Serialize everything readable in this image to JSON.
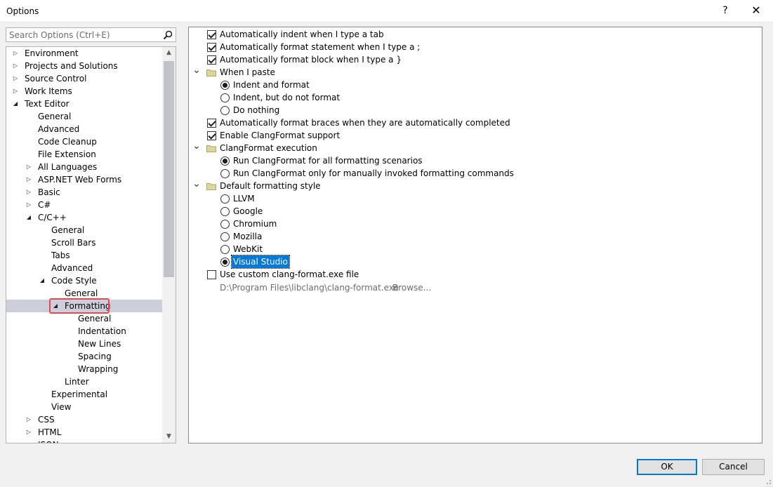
{
  "window": {
    "title": "Options",
    "help_label": "?",
    "close_label": "✕"
  },
  "search": {
    "placeholder": "Search Options (Ctrl+E)"
  },
  "tree": [
    {
      "label": "Environment",
      "indent": 0,
      "arrow": "collapsed"
    },
    {
      "label": "Projects and Solutions",
      "indent": 0,
      "arrow": "collapsed"
    },
    {
      "label": "Source Control",
      "indent": 0,
      "arrow": "collapsed"
    },
    {
      "label": "Work Items",
      "indent": 0,
      "arrow": "collapsed"
    },
    {
      "label": "Text Editor",
      "indent": 0,
      "arrow": "expanded"
    },
    {
      "label": "General",
      "indent": 1,
      "arrow": "none"
    },
    {
      "label": "Advanced",
      "indent": 1,
      "arrow": "none"
    },
    {
      "label": "Code Cleanup",
      "indent": 1,
      "arrow": "none"
    },
    {
      "label": "File Extension",
      "indent": 1,
      "arrow": "none"
    },
    {
      "label": "All Languages",
      "indent": 1,
      "arrow": "collapsed"
    },
    {
      "label": "ASP.NET Web Forms",
      "indent": 1,
      "arrow": "collapsed"
    },
    {
      "label": "Basic",
      "indent": 1,
      "arrow": "collapsed"
    },
    {
      "label": "C#",
      "indent": 1,
      "arrow": "collapsed"
    },
    {
      "label": "C/C++",
      "indent": 1,
      "arrow": "expanded"
    },
    {
      "label": "General",
      "indent": 2,
      "arrow": "none"
    },
    {
      "label": "Scroll Bars",
      "indent": 2,
      "arrow": "none"
    },
    {
      "label": "Tabs",
      "indent": 2,
      "arrow": "none"
    },
    {
      "label": "Advanced",
      "indent": 2,
      "arrow": "none"
    },
    {
      "label": "Code Style",
      "indent": 2,
      "arrow": "expanded"
    },
    {
      "label": "General",
      "indent": 3,
      "arrow": "none"
    },
    {
      "label": "Formatting",
      "indent": 3,
      "arrow": "expanded",
      "selected": true,
      "highlighted": true
    },
    {
      "label": "General",
      "indent": 4,
      "arrow": "none"
    },
    {
      "label": "Indentation",
      "indent": 4,
      "arrow": "none"
    },
    {
      "label": "New Lines",
      "indent": 4,
      "arrow": "none"
    },
    {
      "label": "Spacing",
      "indent": 4,
      "arrow": "none"
    },
    {
      "label": "Wrapping",
      "indent": 4,
      "arrow": "none"
    },
    {
      "label": "Linter",
      "indent": 3,
      "arrow": "none"
    },
    {
      "label": "Experimental",
      "indent": 2,
      "arrow": "none"
    },
    {
      "label": "View",
      "indent": 2,
      "arrow": "none"
    },
    {
      "label": "CSS",
      "indent": 1,
      "arrow": "collapsed"
    },
    {
      "label": "HTML",
      "indent": 1,
      "arrow": "collapsed"
    },
    {
      "label": "JSON",
      "indent": 1,
      "arrow": "collapsed"
    }
  ],
  "options": [
    {
      "kind": "checkbox",
      "label": "Automatically indent when I type a tab",
      "checked": true,
      "level": 1
    },
    {
      "kind": "checkbox",
      "label": "Automatically format statement when I type a ;",
      "checked": true,
      "level": 1
    },
    {
      "kind": "checkbox",
      "label": "Automatically format block when I type a }",
      "checked": true,
      "level": 1
    },
    {
      "kind": "group",
      "label": "When I paste",
      "level": 0
    },
    {
      "kind": "radio",
      "label": "Indent and format",
      "checked": true,
      "level": 2
    },
    {
      "kind": "radio",
      "label": "Indent, but do not format",
      "checked": false,
      "level": 2
    },
    {
      "kind": "radio",
      "label": "Do nothing",
      "checked": false,
      "level": 2
    },
    {
      "kind": "checkbox",
      "label": "Automatically format braces when they are automatically completed",
      "checked": true,
      "level": 1
    },
    {
      "kind": "checkbox",
      "label": "Enable ClangFormat support",
      "checked": true,
      "level": 1
    },
    {
      "kind": "group",
      "label": "ClangFormat execution",
      "level": 0
    },
    {
      "kind": "radio",
      "label": "Run ClangFormat for all formatting scenarios",
      "checked": true,
      "level": 2
    },
    {
      "kind": "radio",
      "label": "Run ClangFormat only for manually invoked formatting commands",
      "checked": false,
      "level": 2
    },
    {
      "kind": "group",
      "label": "Default formatting style",
      "level": 0
    },
    {
      "kind": "radio",
      "label": "LLVM",
      "checked": false,
      "level": 2
    },
    {
      "kind": "radio",
      "label": "Google",
      "checked": false,
      "level": 2
    },
    {
      "kind": "radio",
      "label": "Chromium",
      "checked": false,
      "level": 2
    },
    {
      "kind": "radio",
      "label": "Mozilla",
      "checked": false,
      "level": 2
    },
    {
      "kind": "radio",
      "label": "WebKit",
      "checked": false,
      "level": 2
    },
    {
      "kind": "radio",
      "label": "Visual Studio",
      "checked": true,
      "level": 2,
      "selected": true
    },
    {
      "kind": "checkbox",
      "label": "Use custom clang-format.exe file",
      "checked": false,
      "level": 1
    }
  ],
  "custom_path": {
    "value": "D:\\Program Files\\libclang\\clang-format.exe",
    "browse_label": "Browse..."
  },
  "buttons": {
    "ok": "OK",
    "cancel": "Cancel"
  },
  "colors": {
    "selection": "#0078d7",
    "tree_selected": "#cccedb",
    "highlight_box": "#e8474c"
  }
}
